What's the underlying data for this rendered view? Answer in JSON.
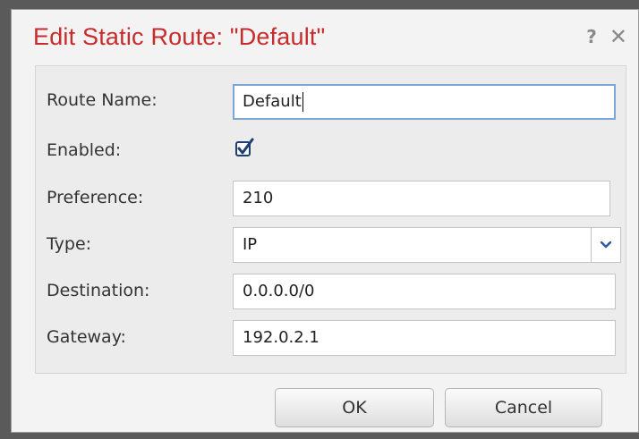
{
  "dialog": {
    "title": "Edit Static Route: \"Default\"",
    "help_icon": "?",
    "close_icon": "✕"
  },
  "form": {
    "route_name": {
      "label": "Route Name:",
      "value": "Default"
    },
    "enabled": {
      "label": "Enabled:",
      "checked": true
    },
    "preference": {
      "label": "Preference:",
      "value": "210"
    },
    "type": {
      "label": "Type:",
      "value": "IP"
    },
    "destination": {
      "label": "Destination:",
      "value": "0.0.0.0/0"
    },
    "gateway": {
      "label": "Gateway:",
      "value": "192.0.2.1"
    }
  },
  "buttons": {
    "ok": "OK",
    "cancel": "Cancel"
  },
  "colors": {
    "title": "#c72b2b",
    "focus_border": "#7aa7d6",
    "checkmark": "#1f3f73",
    "select_arrow": "#2c5aa0"
  }
}
